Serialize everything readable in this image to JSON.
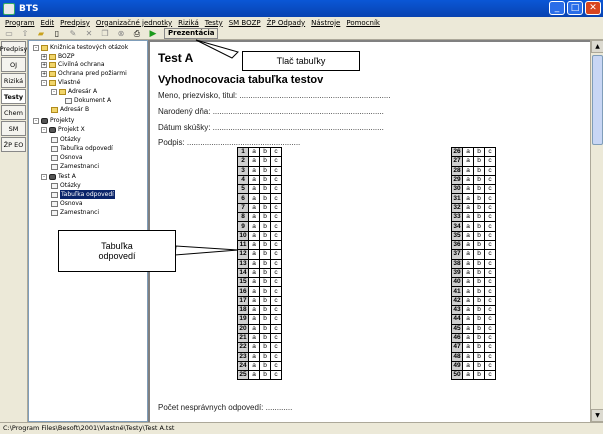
{
  "window": {
    "title": "BTS"
  },
  "menu": [
    "Program",
    "Edit",
    "Predpisy",
    "Organizačné jednotky",
    "Riziká",
    "Testy",
    "SM BOZP",
    "ŽP Odpady",
    "Nástroje",
    "Pomocník"
  ],
  "toolbar": {
    "prezentacia_label": "Prezentácia"
  },
  "left_tabs": [
    "Predpisy",
    "OJ",
    "Riziká",
    "Testy",
    "Chem",
    "SM",
    "ŽP EO"
  ],
  "tree": [
    {
      "label": "Knižnica testových otázok",
      "level": 0,
      "icon": "folder",
      "exp": "-"
    },
    {
      "label": "BOZP",
      "level": 1,
      "icon": "folder",
      "exp": "+"
    },
    {
      "label": "Civilná ochrana",
      "level": 1,
      "icon": "folder",
      "exp": "+"
    },
    {
      "label": "Ochrana pred požiarmi",
      "level": 1,
      "icon": "folder",
      "exp": "+"
    },
    {
      "label": "Vlastné",
      "level": 1,
      "icon": "folder",
      "exp": "-"
    },
    {
      "label": "Adresár A",
      "level": 2,
      "icon": "folder",
      "exp": "-"
    },
    {
      "label": "Dokument A",
      "level": 3,
      "icon": "doc",
      "exp": ""
    },
    {
      "label": "Adresár B",
      "level": 2,
      "icon": "folder",
      "exp": ""
    },
    {
      "label": "Projekty",
      "level": 0,
      "icon": "proj",
      "exp": "-"
    },
    {
      "label": "Projekt X",
      "level": 1,
      "icon": "proj",
      "exp": "-"
    },
    {
      "label": "Otázky",
      "level": 2,
      "icon": "doc",
      "exp": ""
    },
    {
      "label": "Tabuľka odpovedí",
      "level": 2,
      "icon": "doc",
      "exp": ""
    },
    {
      "label": "Osnova",
      "level": 2,
      "icon": "doc",
      "exp": ""
    },
    {
      "label": "Zamestnanci",
      "level": 2,
      "icon": "doc",
      "exp": ""
    },
    {
      "label": "Test A",
      "level": 1,
      "icon": "proj",
      "exp": "-"
    },
    {
      "label": "Otázky",
      "level": 2,
      "icon": "doc",
      "exp": ""
    },
    {
      "label": "Tabuľka odpovedí",
      "level": 2,
      "icon": "doc",
      "exp": "",
      "selected": true
    },
    {
      "label": "Osnova",
      "level": 2,
      "icon": "doc",
      "exp": ""
    },
    {
      "label": "Zamestnanci",
      "level": 2,
      "icon": "doc",
      "exp": ""
    }
  ],
  "doc": {
    "title": "Test A",
    "heading": "Vyhodnocovacia tabuľka testov",
    "fields": [
      "Meno, priezvisko, titul: ....................................................................",
      "Narodený dňa: .............................................................................",
      "Dátum skúšky: .............................................................................",
      "Podpis: ..................................................."
    ],
    "answers": [
      "a",
      "b",
      "c"
    ],
    "col1_numbers": [
      "1",
      "2",
      "3",
      "4",
      "5",
      "6",
      "7",
      "8",
      "9",
      "10",
      "11",
      "12",
      "13",
      "14",
      "15",
      "16",
      "17",
      "18",
      "19",
      "20",
      "21",
      "22",
      "23",
      "24",
      "25"
    ],
    "col2_numbers": [
      "26",
      "27",
      "28",
      "29",
      "30",
      "31",
      "32",
      "33",
      "34",
      "35",
      "36",
      "37",
      "38",
      "39",
      "40",
      "41",
      "42",
      "43",
      "44",
      "45",
      "46",
      "47",
      "48",
      "49",
      "50"
    ],
    "footer": "Počet nesprávnych odpovedí: ............"
  },
  "callouts": {
    "tlac": "Tlač tabuľky",
    "tabulka_line1": "Tabuľka",
    "tabulka_line2": "odpovedí"
  },
  "status": "C:\\Program Files\\Besoft\\2001\\Vlastné\\Testy\\Test A.tst"
}
